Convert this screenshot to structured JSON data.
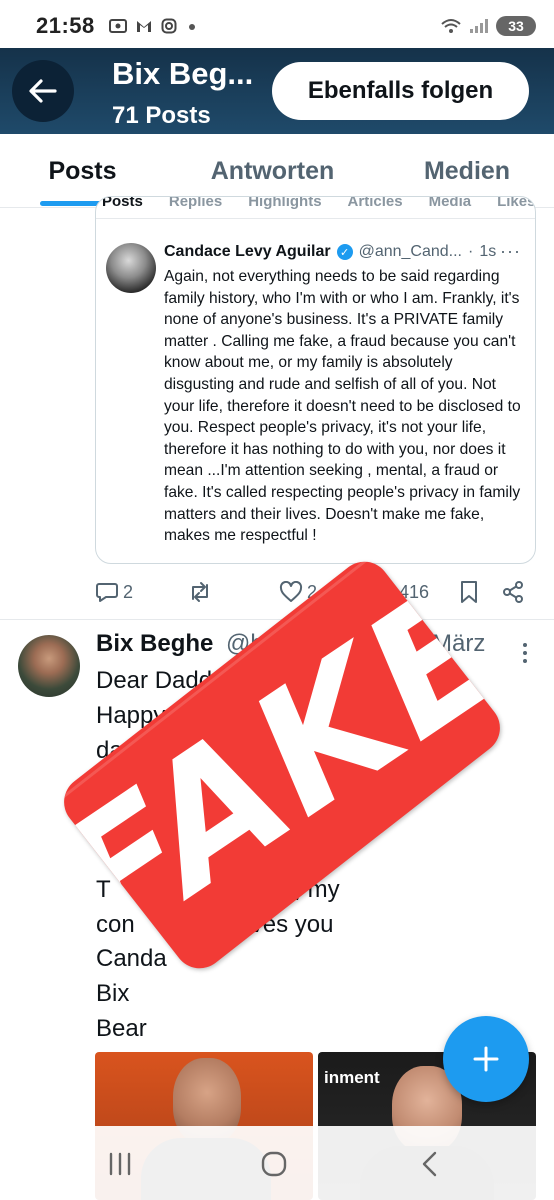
{
  "status_bar": {
    "time": "21:58",
    "icons": [
      "screenshot-icon",
      "gmail-icon",
      "instagram-icon",
      "dot-icon"
    ],
    "battery": "33"
  },
  "header": {
    "name": "Bix Beg...",
    "post_count": "71 Posts",
    "follow_label": "Ebenfalls folgen",
    "accent": "#1d9bf0"
  },
  "tabs": [
    {
      "label": "Posts",
      "active": true
    },
    {
      "label": "Antworten",
      "active": false
    },
    {
      "label": "Medien",
      "active": false
    }
  ],
  "quoted_screenshot": {
    "tabs": [
      "Posts",
      "Replies",
      "Highlights",
      "Articles",
      "Media",
      "Likes"
    ],
    "author_name": "Candace Levy Aguilar",
    "handle": "@ann_Cand...",
    "time": "1s",
    "text": "Again, not everything needs to be said regarding family history, who I'm with or who I am. Frankly, it's none of anyone's business. It's a PRIVATE family matter . Calling me fake, a fraud because you can't know about me, or my family is absolutely disgusting and rude and selfish of all of you. Not your life, therefore it doesn't need to be disclosed to you. Respect people's privacy, it's not your life, therefore it has nothing to do with you, nor does it mean ...I'm attention seeking , mental, a fraud or fake. It's called respecting people's privacy in family matters and their lives. Doesn't make me fake, makes me respectful !"
  },
  "actions": {
    "replies": "2",
    "likes": "2",
    "views": "416"
  },
  "tweet2": {
    "name": "Bix Beghe",
    "handle": "@b",
    "date": "März",
    "text": "Dear Dadd\nHappy                              ial\nday                                  and\n                                    best\n                        and I'm so\n\nT          ng my rock, my\ncon          all loves you\nCanda\nBix\nBear",
    "media_label": "inment"
  },
  "stamp": {
    "text": "FAKE",
    "color": "#f23b36"
  }
}
